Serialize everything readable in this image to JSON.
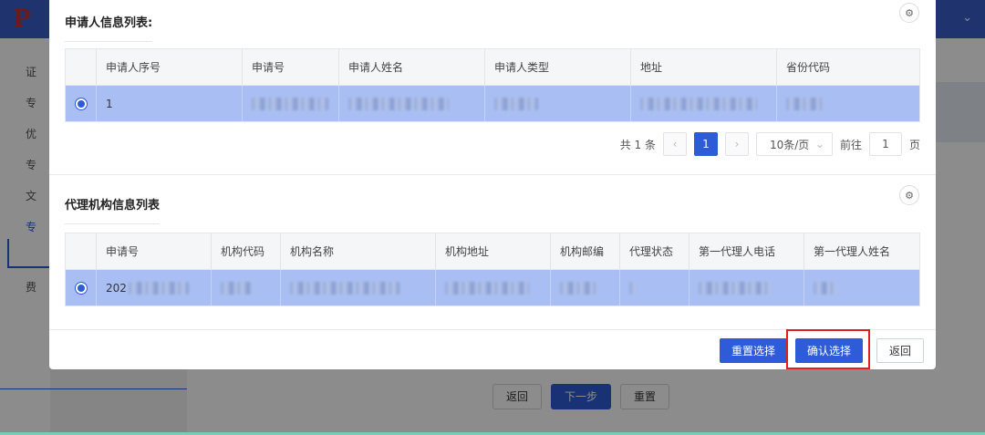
{
  "background": {
    "sidebar_items": [
      "证",
      "专",
      "优",
      "专",
      "文",
      "专",
      "费"
    ],
    "user_chevron": "⌄",
    "buttons": {
      "back": "返回",
      "next": "下一步",
      "reset": "重置"
    }
  },
  "applicant_section": {
    "title": "申请人信息列表:",
    "settings_icon": "gear-icon",
    "columns": [
      "申请人序号",
      "申请号",
      "申请人姓名",
      "申请人类型",
      "地址",
      "省份代码"
    ],
    "rows": [
      {
        "selected": true,
        "cells": [
          "1",
          "",
          "",
          "",
          "",
          ""
        ]
      }
    ],
    "pagination": {
      "total": "共 1 条",
      "prev": "‹",
      "current_page": "1",
      "next": "›",
      "page_size": "10条/页",
      "goto_label": "前往",
      "goto_value": "1",
      "page_suffix": "页"
    }
  },
  "agency_section": {
    "title": "代理机构信息列表",
    "settings_icon": "gear-icon",
    "columns": [
      "申请号",
      "机构代码",
      "机构名称",
      "机构地址",
      "机构邮编",
      "代理状态",
      "第一代理人电话",
      "第一代理人姓名"
    ],
    "rows": [
      {
        "selected": true,
        "cells": [
          "202",
          "",
          "",
          "",
          "",
          "",
          "",
          ""
        ]
      }
    ]
  },
  "footer": {
    "reset_selection": "重置选择",
    "confirm_selection": "确认选择",
    "back": "返回"
  },
  "colors": {
    "primary": "#2e5bd8",
    "selected_row": "#a9bff3",
    "highlight": "#e0201a"
  }
}
